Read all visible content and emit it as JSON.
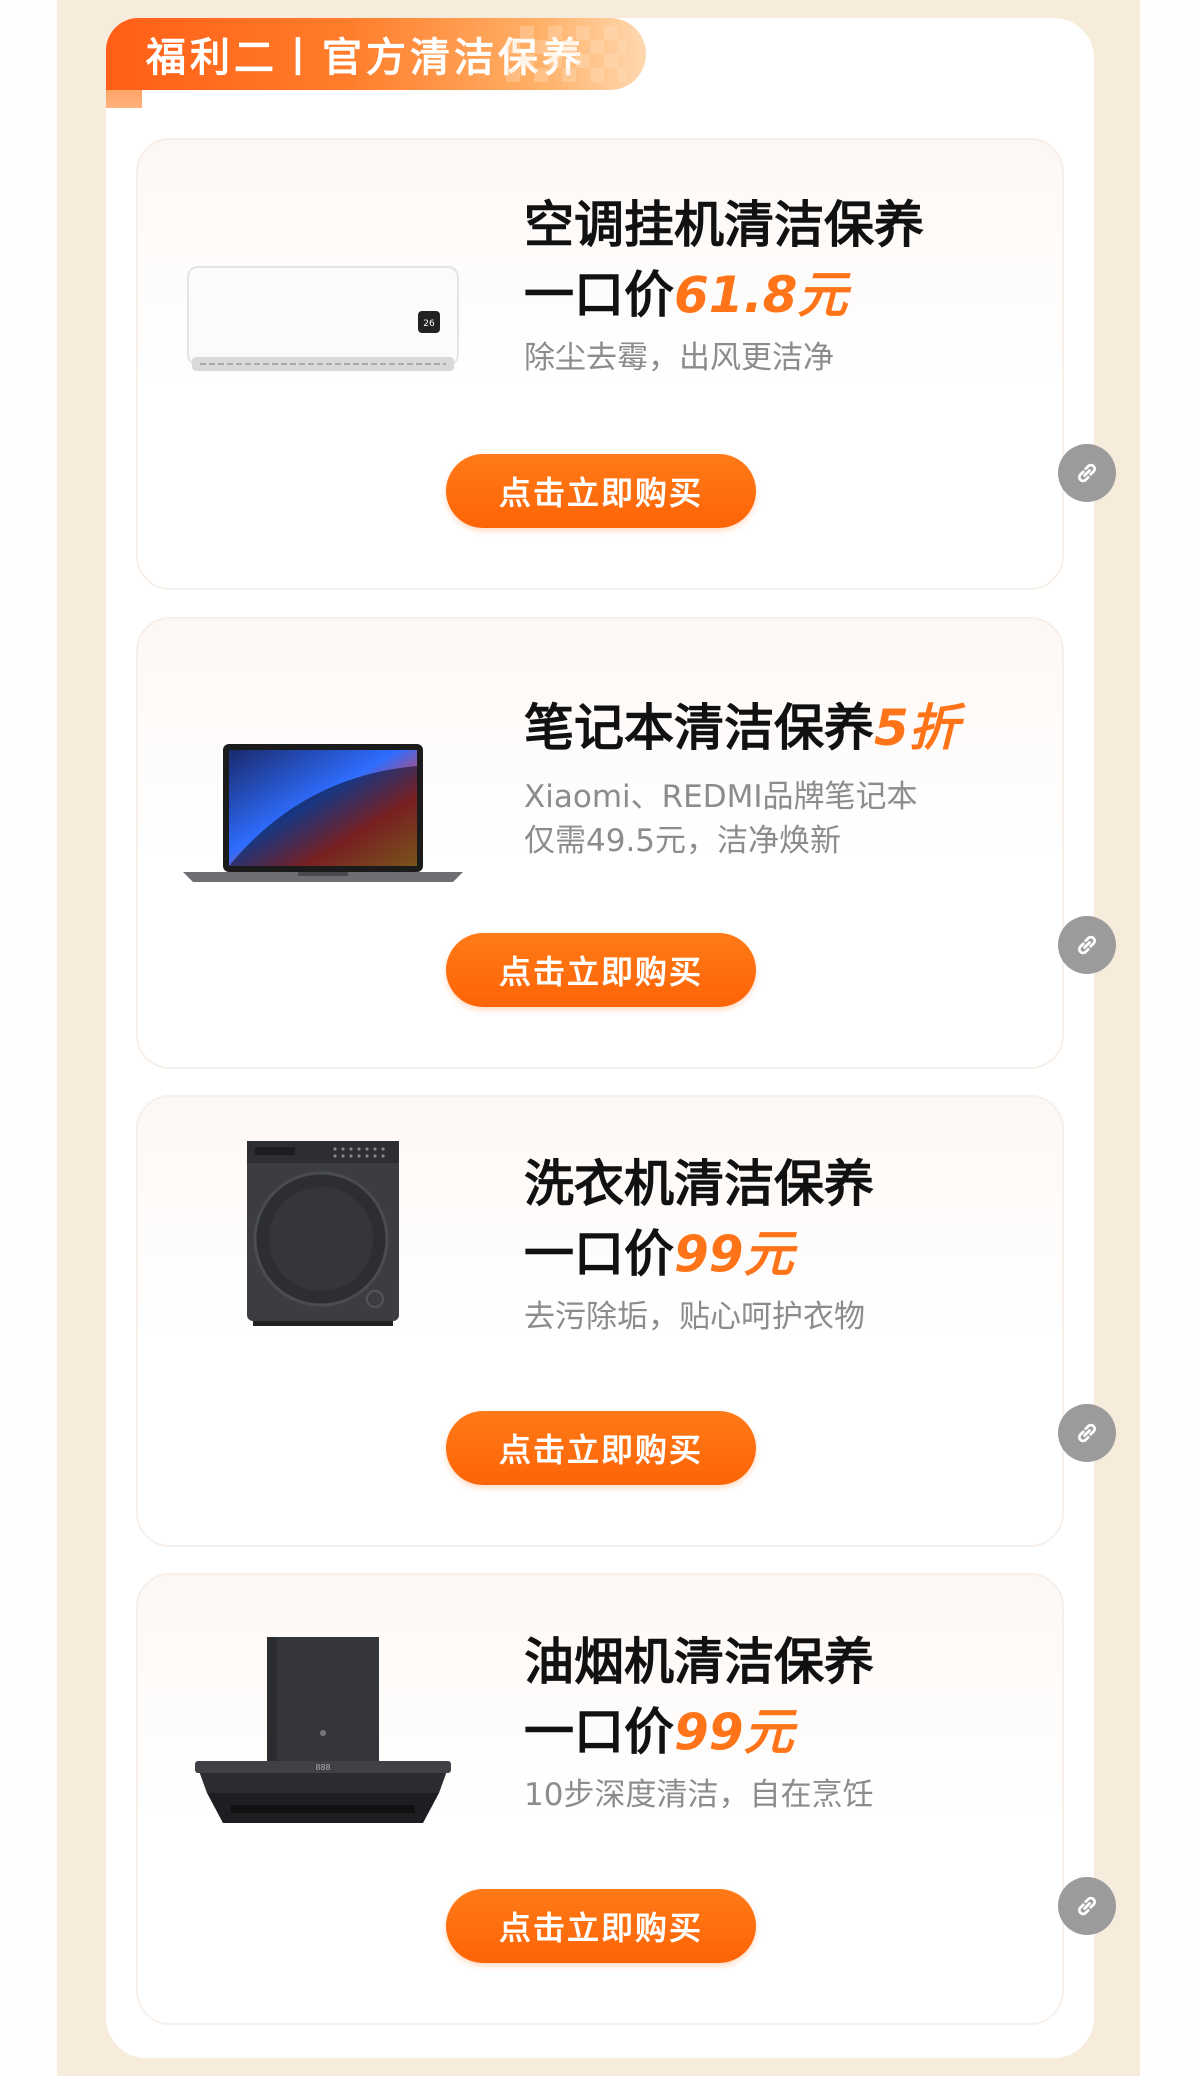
{
  "header": {
    "title": "福利二丨官方清洁保养"
  },
  "cards": [
    {
      "title": "空调挂机清洁保养",
      "price_prefix": "一口价",
      "price": "61.8元",
      "desc": "除尘去霉，出风更洁净",
      "button": "点击立即购买",
      "image_icon": "air-conditioner"
    },
    {
      "title": "笔记本清洁保养",
      "price": "5折",
      "desc1": "Xiaomi、REDMI品牌笔记本",
      "desc2": "仅需49.5元，洁净焕新",
      "button": "点击立即购买",
      "image_icon": "laptop"
    },
    {
      "title": "洗衣机清洁保养",
      "price_prefix": "一口价",
      "price": "99元",
      "desc": "去污除垢，贴心呵护衣物",
      "button": "点击立即购买",
      "image_icon": "washing-machine"
    },
    {
      "title": "油烟机清洁保养",
      "price_prefix": "一口价",
      "price": "99元",
      "desc": "10步深度清洁，自在烹饪",
      "button": "点击立即购买",
      "image_icon": "range-hood"
    }
  ],
  "share_icon": "link-icon",
  "colors": {
    "accent": "#ff7418",
    "band": "#f7ebdc",
    "share": "#9b9b9b"
  }
}
